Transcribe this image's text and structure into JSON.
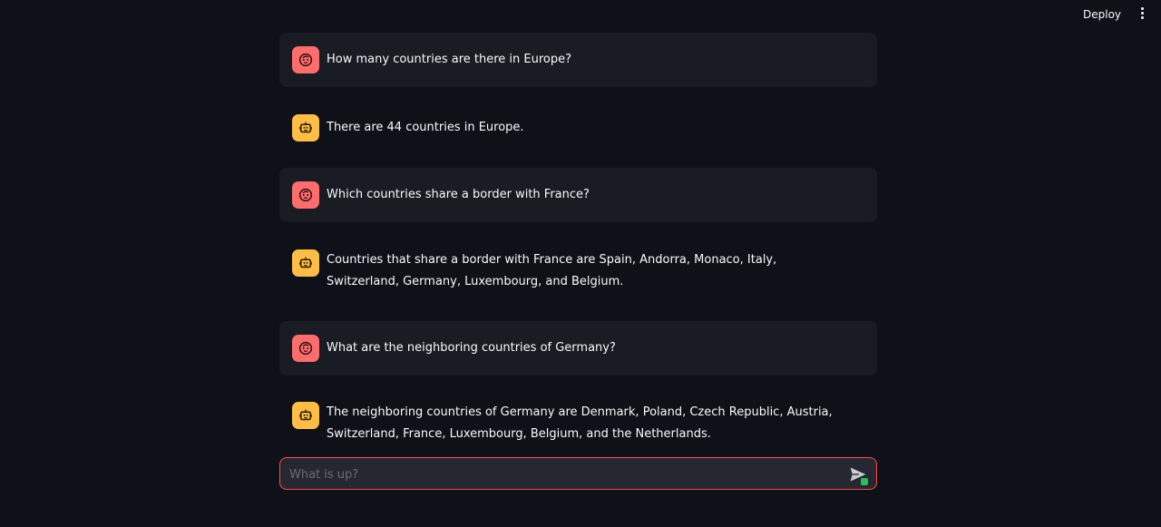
{
  "header": {
    "deploy_label": "Deploy",
    "menu_icon": "vertical-dots-icon"
  },
  "messages": [
    {
      "role": "user",
      "text": "How many countries are there in Europe?"
    },
    {
      "role": "assistant",
      "text": "There are 44 countries in Europe."
    },
    {
      "role": "user",
      "text": "Which countries share a border with France?"
    },
    {
      "role": "assistant",
      "text": "Countries that share a border with France are Spain, Andorra, Monaco, Italy, Switzerland, Germany, Luxembourg, and Belgium."
    },
    {
      "role": "user",
      "text": "What are the neighboring countries of Germany?"
    },
    {
      "role": "assistant",
      "text": "The neighboring countries of Germany are Denmark, Poland, Czech Republic, Austria, Switzerland, France, Luxembourg, Belgium, and the Netherlands."
    }
  ],
  "chat_input": {
    "placeholder": "What is up?",
    "value": "",
    "send_icon": "send-icon"
  },
  "colors": {
    "user_avatar": "#ff6c6c",
    "bot_avatar": "#ffbd45",
    "accent_border": "#ff4b4b",
    "background": "#0e1117"
  }
}
